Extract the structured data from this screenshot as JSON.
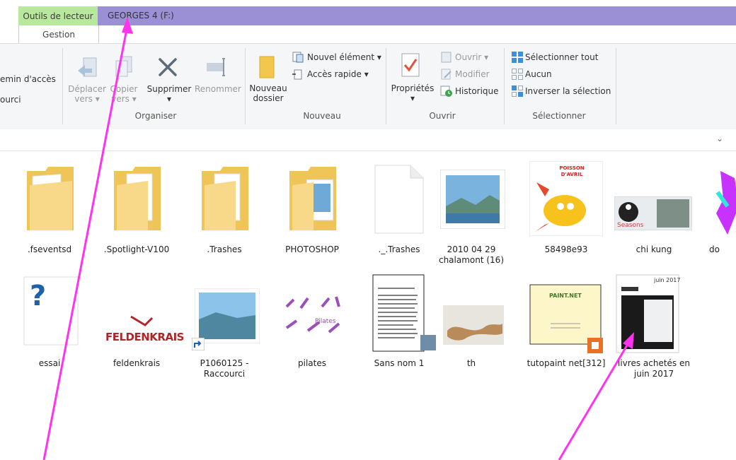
{
  "titlebar": {
    "context_tab": "Outils de lecteur",
    "window_title": "GEORGES 4 (F:)",
    "subtab": "Gestion"
  },
  "ribbon": {
    "left_cut": {
      "line1": "emin d'accès",
      "line2": "ourci"
    },
    "organiser": {
      "label": "Organiser",
      "move": {
        "line1": "Déplacer",
        "line2": "vers"
      },
      "copy": {
        "line1": "Copier",
        "line2": "vers"
      },
      "delete": "Supprimer",
      "rename": "Renommer"
    },
    "nouveau": {
      "label": "Nouveau",
      "new_folder": {
        "line1": "Nouveau",
        "line2": "dossier"
      },
      "new_item": "Nouvel élément",
      "quick_access": "Accès rapide"
    },
    "ouvrir": {
      "label": "Ouvrir",
      "properties": "Propriétés",
      "open": "Ouvrir",
      "edit": "Modifier",
      "history": "Historique"
    },
    "selectionner": {
      "label": "Sélectionner",
      "select_all": "Sélectionner tout",
      "none": "Aucun",
      "invert": "Inverser la sélection"
    }
  },
  "files": [
    {
      "name": ".fseventsd",
      "type": "folder-docs"
    },
    {
      "name": ".Spotlight-V100",
      "type": "folder-docs"
    },
    {
      "name": ".Trashes",
      "type": "folder-docs"
    },
    {
      "name": "PHOTOSHOP",
      "type": "folder-photo"
    },
    {
      "name": "._.Trashes",
      "type": "blank"
    },
    {
      "name": "2010 04 29 chalamont (16)",
      "type": "image"
    },
    {
      "name": "58498e93",
      "type": "image"
    },
    {
      "name": "chi kung",
      "type": "image"
    },
    {
      "name": "do",
      "type": "image"
    },
    {
      "name": "essai",
      "type": "unknown"
    },
    {
      "name": "feldenkrais",
      "type": "image"
    },
    {
      "name": "P1060125 - Raccourci",
      "type": "shortcut"
    },
    {
      "name": "pilates",
      "type": "image"
    },
    {
      "name": "Sans nom 1",
      "type": "document"
    },
    {
      "name": "th",
      "type": "image"
    },
    {
      "name": "tutopaint net[312]",
      "type": "document"
    },
    {
      "name": "livres achetés en juin 2017",
      "type": "document"
    }
  ],
  "thumb_text": {
    "poisson": "POISSON\nD'AVRIL",
    "seasons": "Seasons",
    "feldenkrais": "FELDENKRAIS",
    "pilates": "Pilates",
    "paintnet": "PAINT.NET",
    "juin": "juin 2017"
  },
  "colors": {
    "context_tab": "#b8e89d",
    "title_strip": "#9b8fd6",
    "annotation_arrow": "#ff33ee",
    "folder": "#f8d775"
  }
}
